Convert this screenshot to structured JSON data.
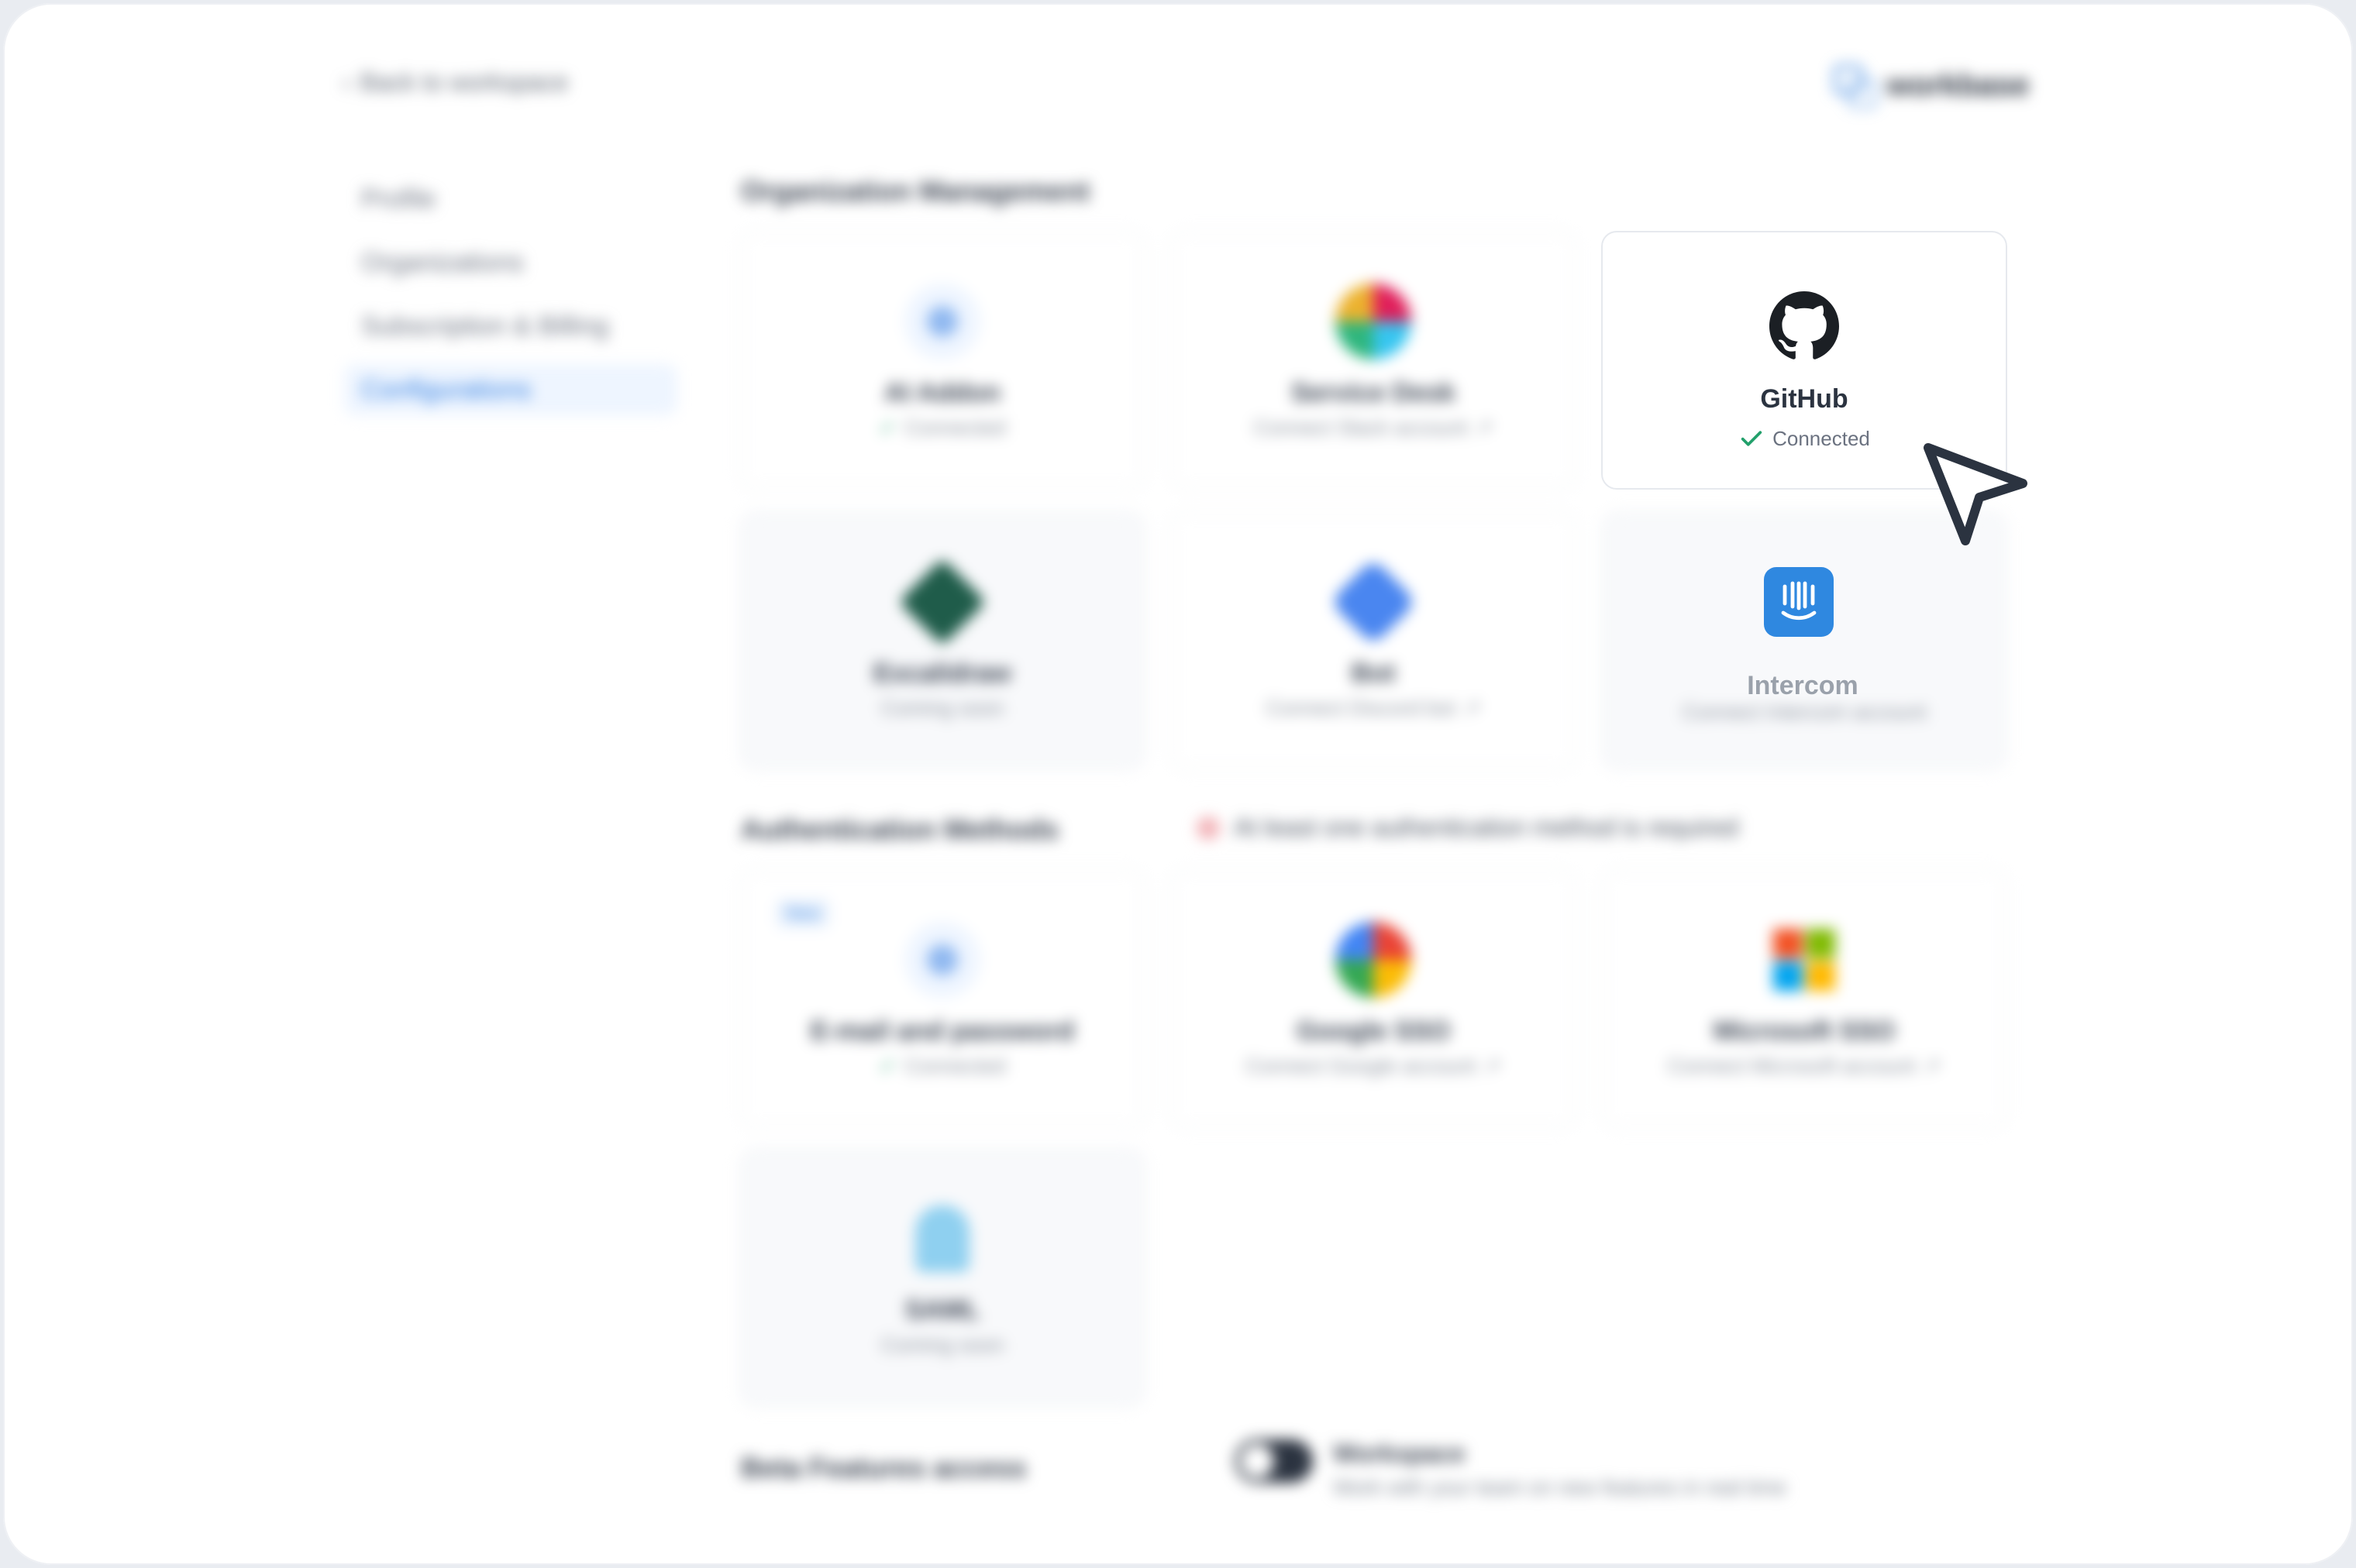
{
  "header": {
    "back_label": "Back to workspace",
    "brand_name": "workbase"
  },
  "sidebar": {
    "items": [
      {
        "label": "Profile",
        "active": false
      },
      {
        "label": "Organizations",
        "active": false
      },
      {
        "label": "Subscription & Billing",
        "active": false
      },
      {
        "label": "Configurations",
        "active": true
      }
    ]
  },
  "org_section": {
    "title": "Organization Management",
    "cards": [
      {
        "name": "AI Addon",
        "status": "Connected",
        "icon": "sparkle-icon"
      },
      {
        "name": "Service Desk",
        "status": "Connect Slack account",
        "icon": "slack-icon"
      },
      {
        "name": "GitHub",
        "status": "Connected",
        "icon": "github-icon"
      },
      {
        "name": "Excalidraw",
        "status": "Coming soon",
        "icon": "excalidraw-icon"
      },
      {
        "name": "Bot",
        "status": "Connect Discord bot",
        "icon": "bot-icon"
      },
      {
        "name": "Intercom",
        "status": "Connect Intercom account",
        "icon": "intercom-icon"
      }
    ]
  },
  "auth_section": {
    "title": "Authentication Methods",
    "warning": "At least one authentication method is required",
    "cards": [
      {
        "name": "E-mail and password",
        "status": "Connected",
        "icon": "key-icon",
        "badge": "New"
      },
      {
        "name": "Google SSO",
        "status": "Connect Google account",
        "icon": "google-icon"
      },
      {
        "name": "Microsoft SSO",
        "status": "Connect Microsoft account",
        "icon": "microsoft-icon"
      },
      {
        "name": "SAML",
        "status": "Coming soon",
        "icon": "saml-icon"
      }
    ]
  },
  "beta_section": {
    "title": "Beta Features access",
    "toggle_label": "Workspace",
    "toggle_desc": "Work with your team on new features in real time"
  },
  "colors": {
    "accent": "#2f7de1",
    "success": "#22a06b",
    "intercom": "#2f88e0",
    "github": "#1b1f24"
  }
}
